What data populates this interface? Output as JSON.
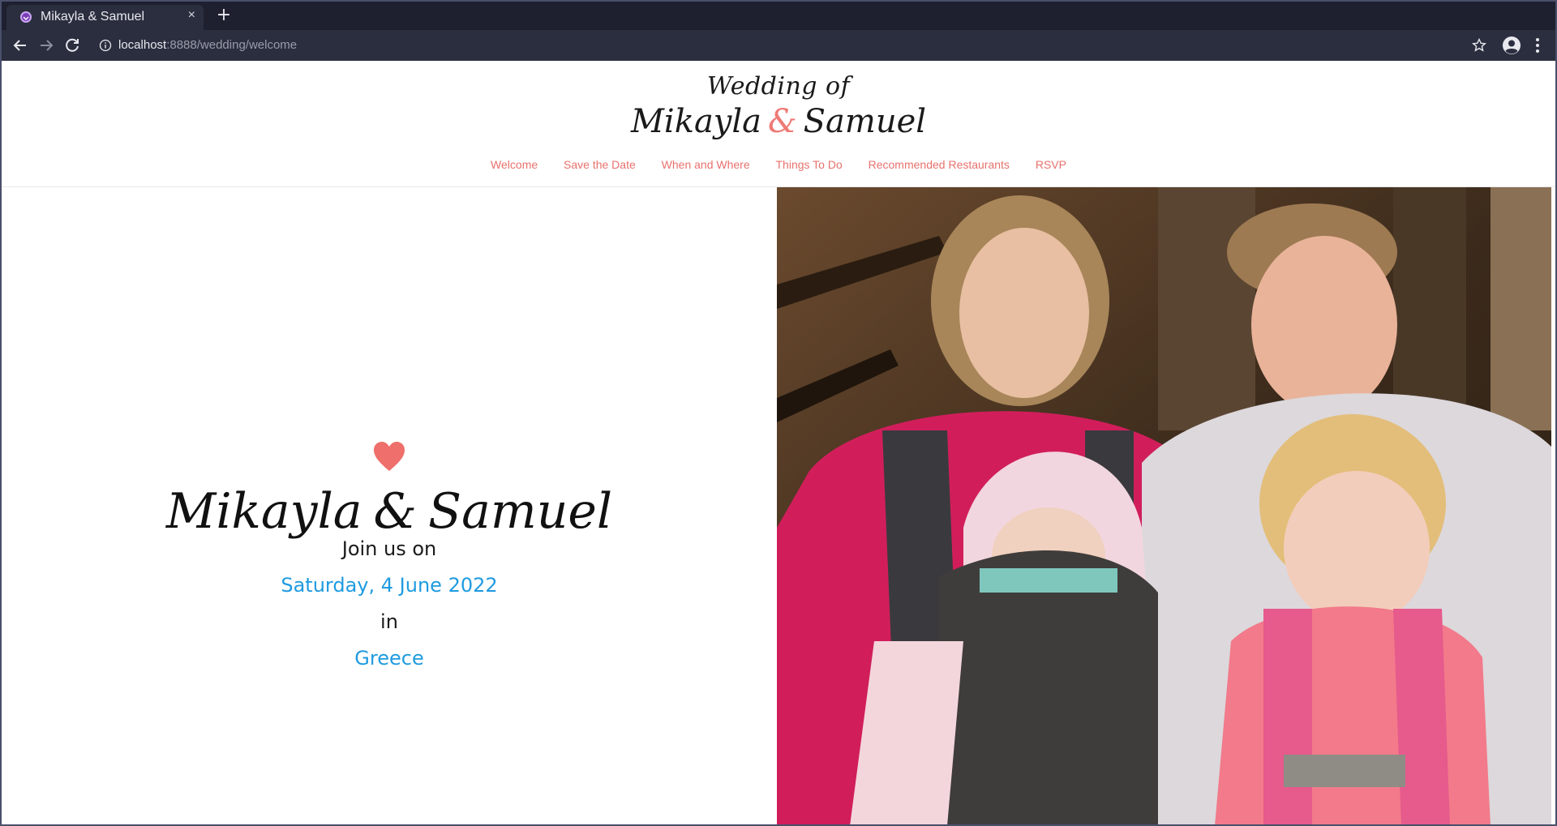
{
  "browser": {
    "tab_title": "Mikayla & Samuel",
    "tab_close": "×",
    "new_tab": "+",
    "url_host": "localhost",
    "url_path": ":8888/wedding/welcome"
  },
  "header": {
    "logo_top": "Wedding of",
    "logo_name_1": "Mikayla",
    "logo_amp": "&",
    "logo_name_2": "Samuel"
  },
  "nav": {
    "items": [
      {
        "label": "Welcome"
      },
      {
        "label": "Save the Date"
      },
      {
        "label": "When and Where"
      },
      {
        "label": "Things To Do"
      },
      {
        "label": "Recommended Restaurants"
      },
      {
        "label": "RSVP"
      }
    ]
  },
  "hero": {
    "name_1": "Mikayla",
    "amp": "&",
    "name_2": "Samuel",
    "join_text": "Join us on",
    "date": "Saturday, 4 June 2022",
    "in_text": "in",
    "location": "Greece"
  },
  "colors": {
    "accent": "#e8716d",
    "link_blue": "#1f9be0",
    "chrome_dark": "#1e2030",
    "chrome_toolbar": "#2b2e3f"
  },
  "icons": {
    "favicon": "gatsby-logo-icon",
    "back": "arrow-left-icon",
    "forward": "arrow-right-icon",
    "reload": "reload-icon",
    "info": "info-icon",
    "star": "star-icon",
    "profile": "profile-icon",
    "menu": "kebab-menu-icon",
    "heart": "heart-icon"
  }
}
